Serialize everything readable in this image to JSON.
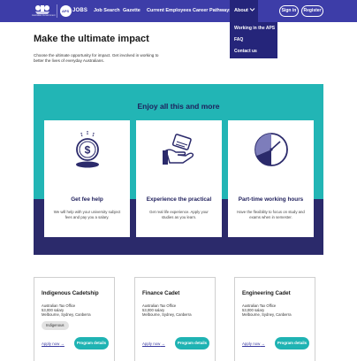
{
  "nav": {
    "crest_text": "Australian Government",
    "logo_aps": "APS",
    "logo_jobs": "JOBS",
    "links": [
      "Job Search",
      "Gazette",
      "Current Employees",
      "Career Pathways"
    ],
    "about": "About",
    "sign_in": "Sign in",
    "register": "Register"
  },
  "dropdown": {
    "items": [
      "Working in the APS",
      "FAQ",
      "Contact us"
    ]
  },
  "intro": {
    "title": "Make the ultimate impact",
    "text": "Choose the ultimate opportunity for impact. Get involved in working to better the lives of everyday Australians."
  },
  "benefits": {
    "title": "Enjoy all this and more",
    "cards": [
      {
        "icon": "dollar-coin-icon",
        "title": "Get fee help",
        "text": "We will help with your university subject fees and pay you a salary."
      },
      {
        "icon": "hand-holding-card-icon",
        "title": "Experience the practical",
        "text": "Get real life experience. Apply your studies as you learn."
      },
      {
        "icon": "clock-icon",
        "title": "Part-time working hours",
        "text": "Have the flexibility to focus on study and exams when in semester."
      }
    ]
  },
  "programs": [
    {
      "title": "Indigenous Cadetship",
      "org": "Australian Tax Office",
      "salary": "53,000 salary",
      "location": "Melbourne, Sydney, Canberra",
      "tag": "Indigenous",
      "apply": "Apply now",
      "details": "Program details"
    },
    {
      "title": "Finance Cadet",
      "org": "Australian Tax Office",
      "salary": "53,000 salary",
      "location": "Melbourne, Sydney, Canberra",
      "tag": "",
      "apply": "Apply now",
      "details": "Program details"
    },
    {
      "title": "Engineering Cadet",
      "org": "Australian Tax Office",
      "salary": "53,000 salary",
      "location": "Melbourne, Sydney, Canberra",
      "tag": "",
      "apply": "Apply now",
      "details": "Program details"
    }
  ],
  "colors": {
    "nav_bg": "#3d3da8",
    "about_active": "#25257a",
    "teal": "#22b5b5",
    "navy": "#2b2a6b",
    "button": "#1fb3b3"
  }
}
